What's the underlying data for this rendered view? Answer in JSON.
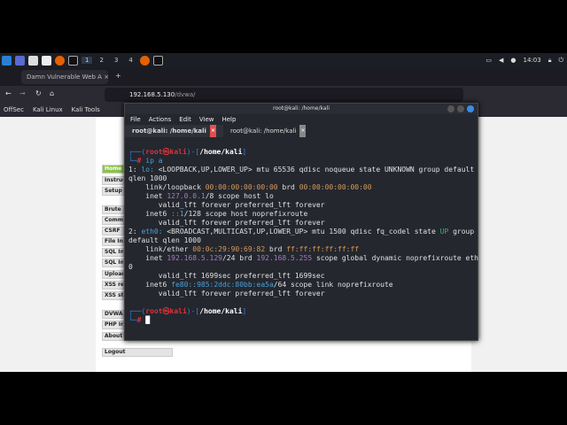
{
  "taskbar": {
    "workspaces": [
      "1",
      "2",
      "3",
      "4"
    ],
    "clock": "14:03"
  },
  "browser": {
    "tab_title": "Damn Vulnerable Web A",
    "url_host": "192.168.5.130",
    "url_path": "/dvwa/",
    "bookmarks": [
      "OffSec",
      "Kali Linux",
      "Kali Tools"
    ]
  },
  "dvwa": {
    "menu": [
      "Home",
      "Instruct",
      "Setup",
      "Brute F",
      "Comma",
      "CSRF",
      "File Incl",
      "SQL Inj",
      "SQL Inj",
      "Upload",
      "XSS refl",
      "XSS stor",
      "DVWA S",
      "PHP Info",
      "About"
    ],
    "logout": "Logout"
  },
  "terminal": {
    "title": "root@kali: /home/kali",
    "menu": [
      "File",
      "Actions",
      "Edit",
      "View",
      "Help"
    ],
    "tabs": [
      "root@kali: /home/kali",
      "root@kali: /home/kali"
    ],
    "colors": {
      "red": "#e0303a",
      "blue": "#3a7fe0",
      "orange": "#d79a5a",
      "purple": "#a37ac0",
      "green": "#3cb371",
      "cyan": "#4aa0d8"
    },
    "lines": [
      [
        [
          "┌──(",
          "blue"
        ],
        [
          "root㉿kali",
          "red"
        ],
        [
          ")-[",
          "blue"
        ],
        [
          "/home/kali",
          "white"
        ],
        [
          "]",
          "blue"
        ]
      ],
      [
        [
          "└─",
          "blue"
        ],
        [
          "# ",
          "red"
        ],
        [
          "ip a",
          "cyan"
        ]
      ],
      [
        [
          "1: ",
          ""
        ],
        [
          "lo:",
          "cyan"
        ],
        [
          " <LOOPBACK,UP,LOWER_UP> mtu 65536 qdisc noqueue state UNKNOWN group default",
          ""
        ]
      ],
      [
        [
          "qlen 1000",
          ""
        ]
      ],
      [
        [
          "    link/loopback ",
          ""
        ],
        [
          "00:00:00:00:00:00",
          "orange"
        ],
        [
          " brd ",
          ""
        ],
        [
          "00:00:00:00:00:00",
          "orange"
        ]
      ],
      [
        [
          "    inet ",
          ""
        ],
        [
          "127.0.0.1",
          "purple"
        ],
        [
          "/8 scope host lo",
          ""
        ]
      ],
      [
        [
          "       valid_lft forever preferred_lft forever",
          ""
        ]
      ],
      [
        [
          "    inet6 ",
          ""
        ],
        [
          "::1",
          "cyan"
        ],
        [
          "/128 scope host noprefixroute",
          ""
        ]
      ],
      [
        [
          "       valid_lft forever preferred_lft forever",
          ""
        ]
      ],
      [
        [
          "2: ",
          ""
        ],
        [
          "eth0:",
          "cyan"
        ],
        [
          " <BROADCAST,MULTICAST,UP,LOWER_UP> mtu 1500 qdisc fq_codel state ",
          ""
        ],
        [
          "UP",
          "green"
        ],
        [
          " group",
          ""
        ]
      ],
      [
        [
          "default qlen 1000",
          ""
        ]
      ],
      [
        [
          "    link/ether ",
          ""
        ],
        [
          "00:0c:29:90:69:82",
          "orange"
        ],
        [
          " brd ",
          ""
        ],
        [
          "ff:ff:ff:ff:ff:ff",
          "orange"
        ]
      ],
      [
        [
          "    inet ",
          ""
        ],
        [
          "192.168.5.129",
          "purple"
        ],
        [
          "/24 brd ",
          ""
        ],
        [
          "192.168.5.255",
          "purple"
        ],
        [
          " scope global dynamic noprefixroute eth",
          ""
        ]
      ],
      [
        [
          "0",
          ""
        ]
      ],
      [
        [
          "       valid_lft 1699sec preferred_lft 1699sec",
          ""
        ]
      ],
      [
        [
          "    inet6 ",
          ""
        ],
        [
          "fe80::985:2ddc:80bb:ea5a",
          "cyan"
        ],
        [
          "/64 scope link noprefixroute",
          ""
        ]
      ],
      [
        [
          "       valid_lft forever preferred_lft forever",
          ""
        ]
      ],
      [
        [
          "",
          ""
        ]
      ],
      [
        [
          "┌──(",
          "blue"
        ],
        [
          "root㉿kali",
          "red"
        ],
        [
          ")-[",
          "blue"
        ],
        [
          "/home/kali",
          "white"
        ],
        [
          "]",
          "blue"
        ]
      ],
      [
        [
          "└─",
          "blue"
        ],
        [
          "# ",
          "red"
        ],
        [
          "█",
          "white"
        ]
      ]
    ]
  }
}
